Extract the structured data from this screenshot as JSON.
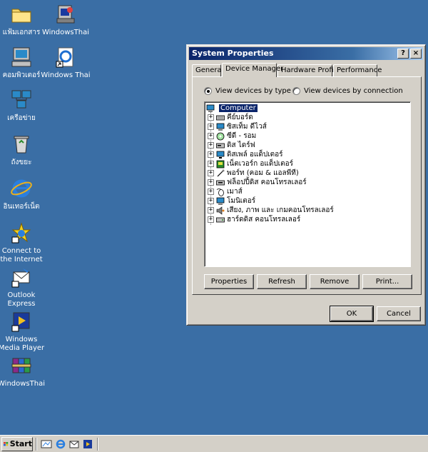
{
  "desktop": {
    "icons": [
      {
        "label": "แฟ้มเอกสาร",
        "icon": "folder-icon"
      },
      {
        "label": "WindowsThai",
        "icon": "windows-thai-setup-icon"
      },
      {
        "label": "คอมพิวเตอร์",
        "icon": "my-computer-icon"
      },
      {
        "label": "Windows Thai",
        "icon": "internet-shortcut-icon"
      },
      {
        "label": "เครือข่าย",
        "icon": "network-icon"
      },
      {
        "label": "ถังขยะ",
        "icon": "recycle-bin-icon"
      },
      {
        "label": "อินเทอร์เน็ต",
        "icon": "internet-explorer-icon"
      },
      {
        "label": "Connect to the Internet",
        "icon": "connect-internet-icon"
      },
      {
        "label": "Outlook Express",
        "icon": "outlook-express-icon"
      },
      {
        "label": "Windows Media Player",
        "icon": "media-player-icon"
      },
      {
        "label": "WindowsThai",
        "icon": "winrar-archive-icon"
      }
    ]
  },
  "window": {
    "title": "System Properties",
    "help_btn": "?",
    "close_btn": "×",
    "tabs": [
      "General",
      "Device Manager",
      "Hardware Profiles",
      "Performance"
    ],
    "active_tab": "Device Manager",
    "radio_by_type": "View devices by type",
    "radio_by_connection": "View devices by connection",
    "tree": {
      "root": "Computer",
      "items": [
        "คีย์บอร์ด",
        "ซิสเท็ม ดีไวส์",
        "ซีดี - รอม",
        "ดิส ไดร์ฟ",
        "ดิสเพล์ อแด็ปเตอร์",
        "เน็ตเวอร์ก อแด็ปเตอร์",
        "พอร์ท (คอม & แอลพีที)",
        "ฟล็อปปี้ดิส คอนโทรลเลอร์",
        "เมาส์",
        "โมนิเตอร์",
        "เสียง, ภาพ และ เกมคอนโทรลเลอร์",
        "ฮาร์ดดิส คอนโทรลเลอร์"
      ]
    },
    "buttons": {
      "properties": "Properties",
      "refresh": "Refresh",
      "remove": "Remove",
      "print": "Print...",
      "ok": "OK",
      "cancel": "Cancel"
    }
  },
  "taskbar": {
    "start_label": "Start",
    "quick_launch": [
      "show-desktop-icon",
      "internet-explorer-icon",
      "outlook-icon",
      "media-player-icon"
    ]
  },
  "colors": {
    "desktop": "#3a6ea5",
    "titlebar": "#0a246a",
    "face": "#d4d0c8"
  }
}
